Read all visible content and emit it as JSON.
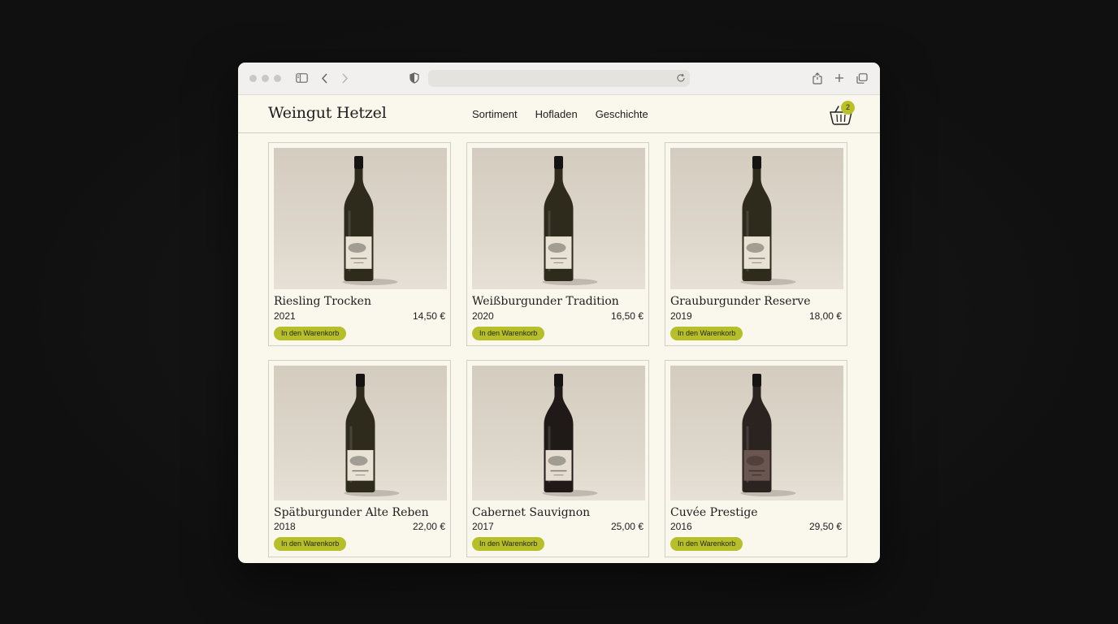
{
  "site": {
    "brand": "Weingut Hetzel",
    "nav": [
      "Sortiment",
      "Hofladen",
      "Geschichte"
    ],
    "cart_count": "2"
  },
  "colors": {
    "accent": "#b6bf2a",
    "background": "#faf7ec",
    "text": "#1d1d1d"
  },
  "products": [
    {
      "name": "Riesling Trocken",
      "year": "2021",
      "price": "14,50 €",
      "button": "In den Warenkorb",
      "wine": "white"
    },
    {
      "name": "Weißburgunder Tradition",
      "year": "2020",
      "price": "16,50 €",
      "button": "In den Warenkorb",
      "wine": "white"
    },
    {
      "name": "Grauburgunder Reserve",
      "year": "2019",
      "price": "18,00 €",
      "button": "In den Warenkorb",
      "wine": "white"
    },
    {
      "name": "Spätburgunder Alte Reben",
      "year": "2018",
      "price": "22,00 €",
      "button": "In den Warenkorb",
      "wine": "white"
    },
    {
      "name": "Cabernet Sauvignon",
      "year": "2017",
      "price": "25,00 €",
      "button": "In den Warenkorb",
      "wine": "red"
    },
    {
      "name": "Cuvée Prestige",
      "year": "2016",
      "price": "29,50 €",
      "button": "In den Warenkorb",
      "wine": "rose"
    }
  ]
}
